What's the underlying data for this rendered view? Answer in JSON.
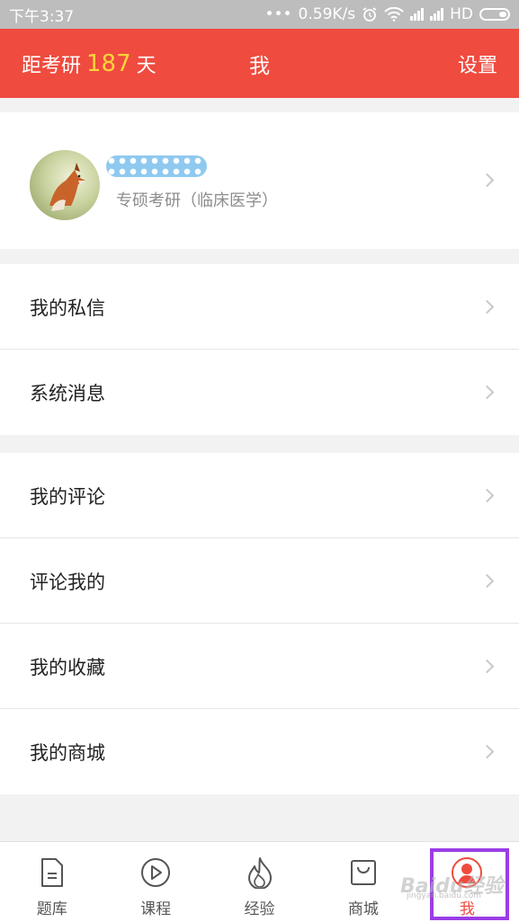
{
  "status_bar": {
    "time": "下午3:37",
    "dots": "•••",
    "speed": "0.59K/s",
    "network": "HD"
  },
  "header": {
    "countdown_prefix": "距考研",
    "countdown_days": "187",
    "countdown_suffix": "天",
    "title": "我",
    "settings": "设置"
  },
  "profile": {
    "subtitle": "专硕考研（临床医学）"
  },
  "menu_group_1": [
    {
      "label": "我的私信"
    },
    {
      "label": "系统消息"
    }
  ],
  "menu_group_2": [
    {
      "label": "我的评论"
    },
    {
      "label": "评论我的"
    },
    {
      "label": "我的收藏"
    },
    {
      "label": "我的商城"
    }
  ],
  "tab_bar": {
    "tabs": [
      {
        "label": "题库",
        "icon": "document-icon"
      },
      {
        "label": "课程",
        "icon": "play-circle-icon"
      },
      {
        "label": "经验",
        "icon": "flame-icon"
      },
      {
        "label": "商城",
        "icon": "shopping-bag-icon"
      },
      {
        "label": "我",
        "icon": "user-icon",
        "active": true
      }
    ]
  },
  "watermark": {
    "brand": "Baidu经验",
    "url": "jingyan.baidu.com"
  },
  "colors": {
    "primary": "#ef4b3f",
    "countdown_highlight": "#ffd33b",
    "selection_outline": "#9b3de6"
  }
}
